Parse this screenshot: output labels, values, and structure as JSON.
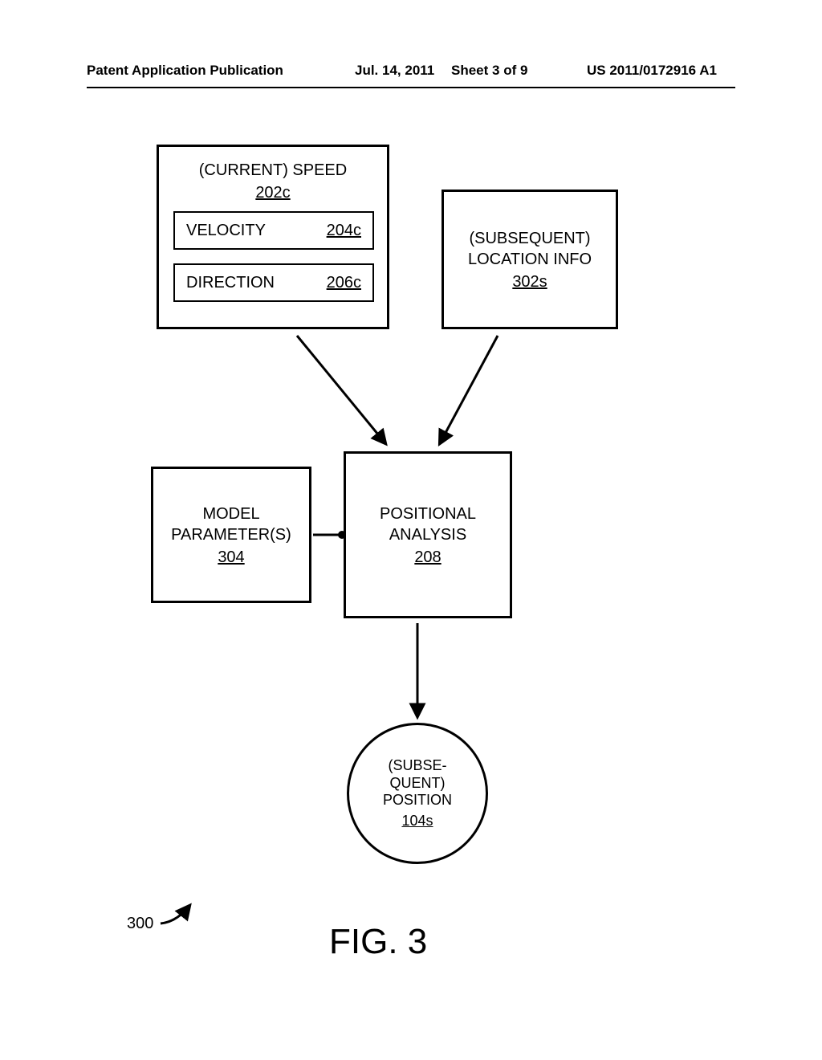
{
  "header": {
    "pub_type": "Patent Application Publication",
    "date": "Jul. 14, 2011",
    "sheet": "Sheet 3 of 9",
    "pub_number": "US 2011/0172916 A1"
  },
  "speed_box": {
    "title_line1": "(CURRENT) SPEED",
    "ref": "202c",
    "velocity_label": "VELOCITY",
    "velocity_ref": "204c",
    "direction_label": "DIRECTION",
    "direction_ref": "206c"
  },
  "location_box": {
    "title_line1": "(SUBSEQUENT)",
    "title_line2": "LOCATION INFO",
    "ref": "302s"
  },
  "model_box": {
    "title_line1": "MODEL",
    "title_line2": "PARAMETER(S)",
    "ref": "304"
  },
  "analysis_box": {
    "title_line1": "POSITIONAL",
    "title_line2": "ANALYSIS",
    "ref": "208"
  },
  "position_oval": {
    "line1": "(SUBSE-",
    "line2": "QUENT)",
    "line3": "POSITION",
    "ref": "104s"
  },
  "figure": {
    "num": "300",
    "caption": "FIG. 3"
  }
}
